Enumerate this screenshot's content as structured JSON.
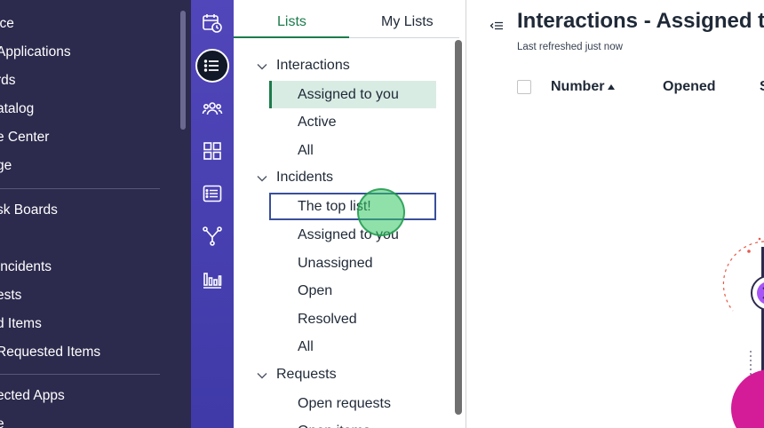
{
  "leftnav": {
    "items": [
      "ice",
      "Applications",
      "rds",
      "atalog",
      "e Center",
      "ge",
      "sk Boards",
      "Incidents",
      "ests",
      "d Items",
      "Requested Items",
      "ected Apps",
      "e"
    ]
  },
  "listpanel": {
    "tabs": {
      "lists": "Lists",
      "my_lists": "My Lists"
    },
    "groups": [
      {
        "label": "Interactions",
        "items": [
          "Assigned to you",
          "Active",
          "All"
        ]
      },
      {
        "label": "Incidents",
        "items": [
          "The top list!",
          "Assigned to you",
          "Unassigned",
          "Open",
          "Resolved",
          "All"
        ]
      },
      {
        "label": "Requests",
        "items": [
          "Open requests",
          "Open items"
        ]
      }
    ]
  },
  "main": {
    "title": "Interactions - Assigned to you",
    "refreshed": "Last refreshed just now",
    "columns": [
      "Number",
      "Opened",
      "S"
    ]
  },
  "colors": {
    "accent": "#1c7b4b",
    "nav_bg": "#2c2a4d",
    "rail": "#4a42b4",
    "selected_bg": "#d9ece4",
    "focus_border": "#3a4f99"
  },
  "icons": [
    "calendar-clock-icon",
    "list-icon",
    "people-group-icon",
    "grid-icon",
    "form-list-icon",
    "workflow-fork-icon",
    "bar-chart-icon"
  ]
}
